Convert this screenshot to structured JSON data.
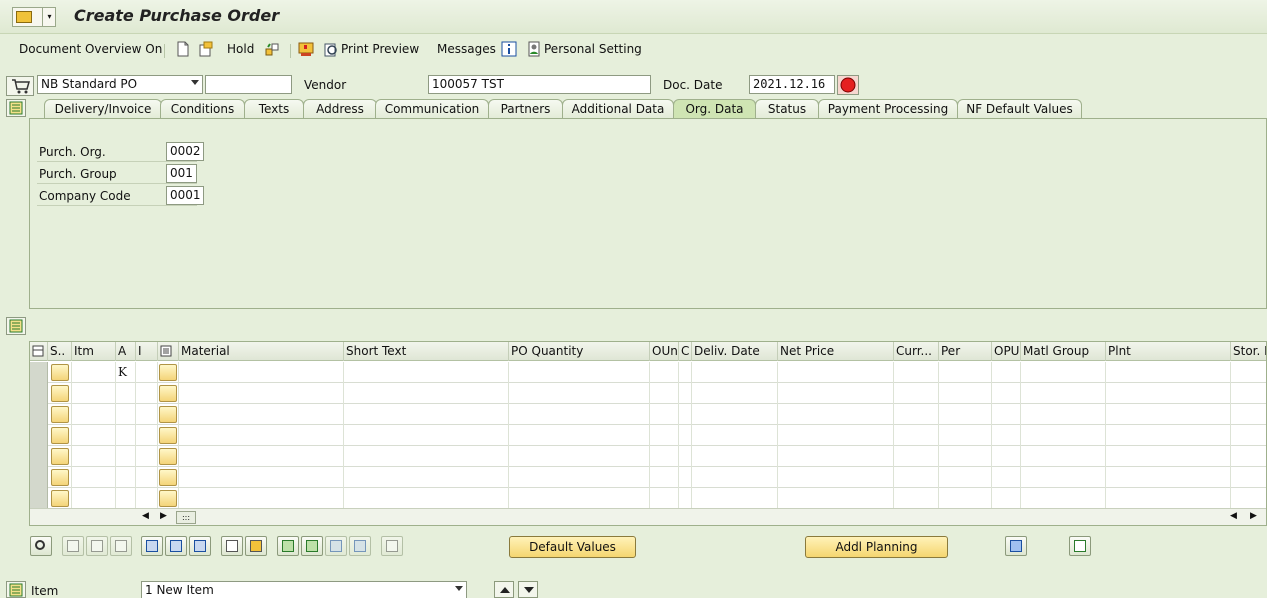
{
  "window": {
    "title": "Create Purchase Order"
  },
  "toolbar": {
    "doc_overview": "Document Overview On",
    "hold": "Hold",
    "print_preview": "Print Preview",
    "messages": "Messages",
    "personal_setting": "Personal Setting"
  },
  "header": {
    "po_type": "NB Standard PO",
    "po_number": "",
    "vendor_label": "Vendor",
    "vendor_value": "100057 TST",
    "doc_date_label": "Doc. Date",
    "doc_date_value": "2021.12.16"
  },
  "tabs": [
    {
      "label": "Delivery/Invoice"
    },
    {
      "label": "Conditions"
    },
    {
      "label": "Texts"
    },
    {
      "label": "Address"
    },
    {
      "label": "Communication"
    },
    {
      "label": "Partners"
    },
    {
      "label": "Additional Data"
    },
    {
      "label": "Org. Data",
      "active": true
    },
    {
      "label": "Status"
    },
    {
      "label": "Payment Processing"
    },
    {
      "label": "NF Default Values"
    }
  ],
  "org_data": {
    "purch_org_label": "Purch. Org.",
    "purch_org_value": "0002",
    "purch_group_label": "Purch. Group",
    "purch_group_value": "001",
    "company_code_label": "Company Code",
    "company_code_value": "0001"
  },
  "items_table": {
    "columns": [
      "S..",
      "Itm",
      "A",
      "I",
      "",
      "Material",
      "Short Text",
      "PO Quantity",
      "OUn",
      "C",
      "Deliv. Date",
      "Net Price",
      "Curr...",
      "Per",
      "OPU",
      "Matl Group",
      "Plnt",
      "Stor. L"
    ],
    "rows": [
      {
        "A": "K"
      },
      {
        "A": ""
      },
      {
        "A": ""
      },
      {
        "A": ""
      },
      {
        "A": ""
      },
      {
        "A": ""
      },
      {
        "A": ""
      }
    ]
  },
  "buttons": {
    "default_values": "Default Values",
    "addl_planning": "Addl Planning"
  },
  "item_bar": {
    "label": "Item",
    "selected": "1 New Item"
  }
}
